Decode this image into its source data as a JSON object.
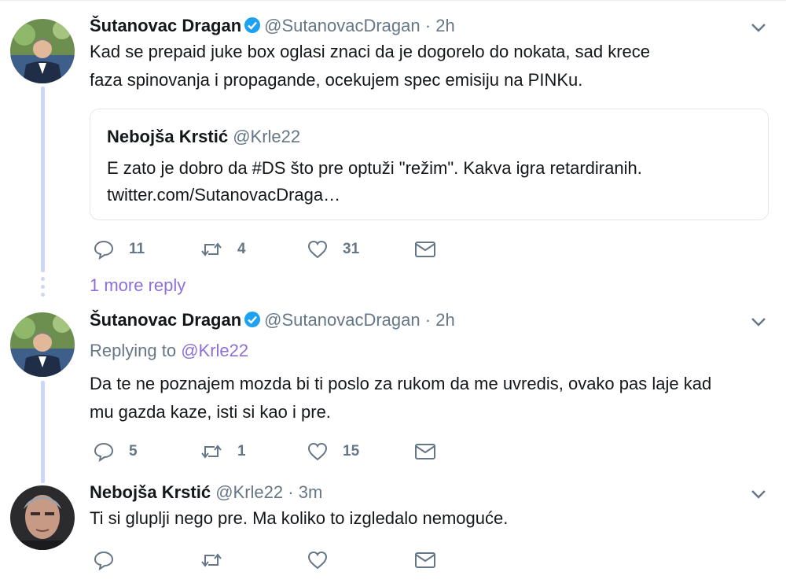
{
  "tweets": [
    {
      "name": "Šutanovac Dragan",
      "handle": "@SutanovacDragan",
      "time": "2h",
      "text_lines": [
        "Kad se prepaid juke box oglasi znaci da je dogorelo do nokata, sad krece",
        "faza spinovanja i propagande, ocekujem spec emisiju na PINKu."
      ],
      "quote": {
        "name": "Nebojša Krstić",
        "handle": "@Krle22",
        "lines": [
          "E zato je dobro da #DS što pre optuži \"režim\". Kakva igra retardiranih.",
          "twitter.com/SutanovacDraga…"
        ]
      },
      "replies": "11",
      "retweets": "4",
      "likes": "31"
    },
    {
      "name": "Šutanovac Dragan",
      "handle": "@SutanovacDragan",
      "time": "2h",
      "replying_prefix": "Replying to",
      "replying_to": "@Krle22",
      "text_lines": [
        "Da te ne poznajem mozda bi ti poslo za rukom da me uvredis, ovako pas laje kad",
        "mu gazda kaze, isti si kao i pre."
      ],
      "replies": "5",
      "retweets": "1",
      "likes": "15"
    },
    {
      "name": "Nebojša Krstić",
      "handle": "@Krle22",
      "time": "3m",
      "text_lines": [
        "Ti si gluplji nego pre. Ma koliko to izgledalo nemoguće."
      ],
      "replies": "",
      "retweets": "",
      "likes": ""
    }
  ],
  "more_reply_label": "1 more reply",
  "separator": "·",
  "colors": {
    "link": "#8e6fd7",
    "thread": "#ccd6f6",
    "verified": "#1da1f2",
    "muted": "#657786"
  },
  "icons": [
    "reply-icon",
    "retweet-icon",
    "like-icon",
    "direct-message-icon",
    "verified-badge-icon",
    "chevron-down-icon"
  ]
}
